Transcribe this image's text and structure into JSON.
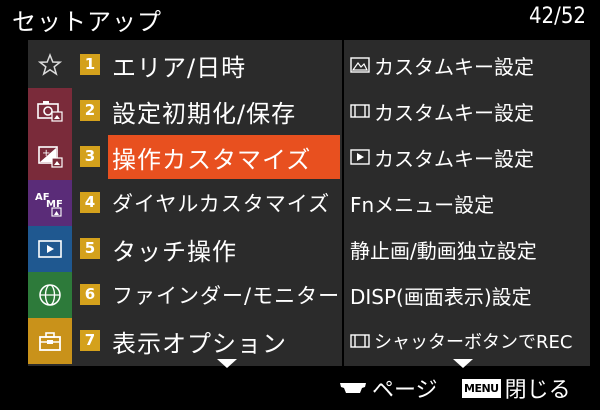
{
  "header": {
    "title": "セットアップ",
    "page_count": "42/52"
  },
  "sidebar": {
    "items": [
      {
        "icon": "star-icon",
        "color": "#2b2b2b"
      },
      {
        "icon": "camera-icon",
        "color": "#7a2b3a"
      },
      {
        "icon": "photo-edit-icon",
        "color": "#7a2b3a"
      },
      {
        "icon": "af-mf-icon",
        "color": "#5a2c78"
      },
      {
        "icon": "playback-icon",
        "color": "#1f5890"
      },
      {
        "icon": "network-globe-icon",
        "color": "#2d7a3a"
      },
      {
        "icon": "toolbox-icon",
        "color": "#c9921a"
      }
    ]
  },
  "menu": {
    "items": [
      {
        "number": "1",
        "label": "エリア/日時"
      },
      {
        "number": "2",
        "label": "設定初期化/保存"
      },
      {
        "number": "3",
        "label": "操作カスタマイズ"
      },
      {
        "number": "4",
        "label": "ダイヤルカスタマイズ"
      },
      {
        "number": "5",
        "label": "タッチ操作"
      },
      {
        "number": "6",
        "label": "ファインダー/モニター"
      },
      {
        "number": "7",
        "label": "表示オプション"
      }
    ],
    "selected_index": 2,
    "highlight_color": "#e8501f",
    "number_color": "#d4a11c"
  },
  "submenu": {
    "items": [
      {
        "icon": "photo-mode-icon",
        "label": "カスタムキー設定"
      },
      {
        "icon": "movie-mode-icon",
        "label": "カスタムキー設定"
      },
      {
        "icon": "playback-mode-icon",
        "label": "カスタムキー設定"
      },
      {
        "icon": "",
        "label": "Fnメニュー設定"
      },
      {
        "icon": "",
        "label": "静止画/動画独立設定"
      },
      {
        "icon": "",
        "label": "DISP(画面表示)設定"
      },
      {
        "icon": "movie-mode-icon",
        "label": "シャッターボタンでREC"
      }
    ]
  },
  "footer": {
    "page_label": "ページ",
    "menu_chip": "MENU",
    "close_label": "閉じる"
  }
}
